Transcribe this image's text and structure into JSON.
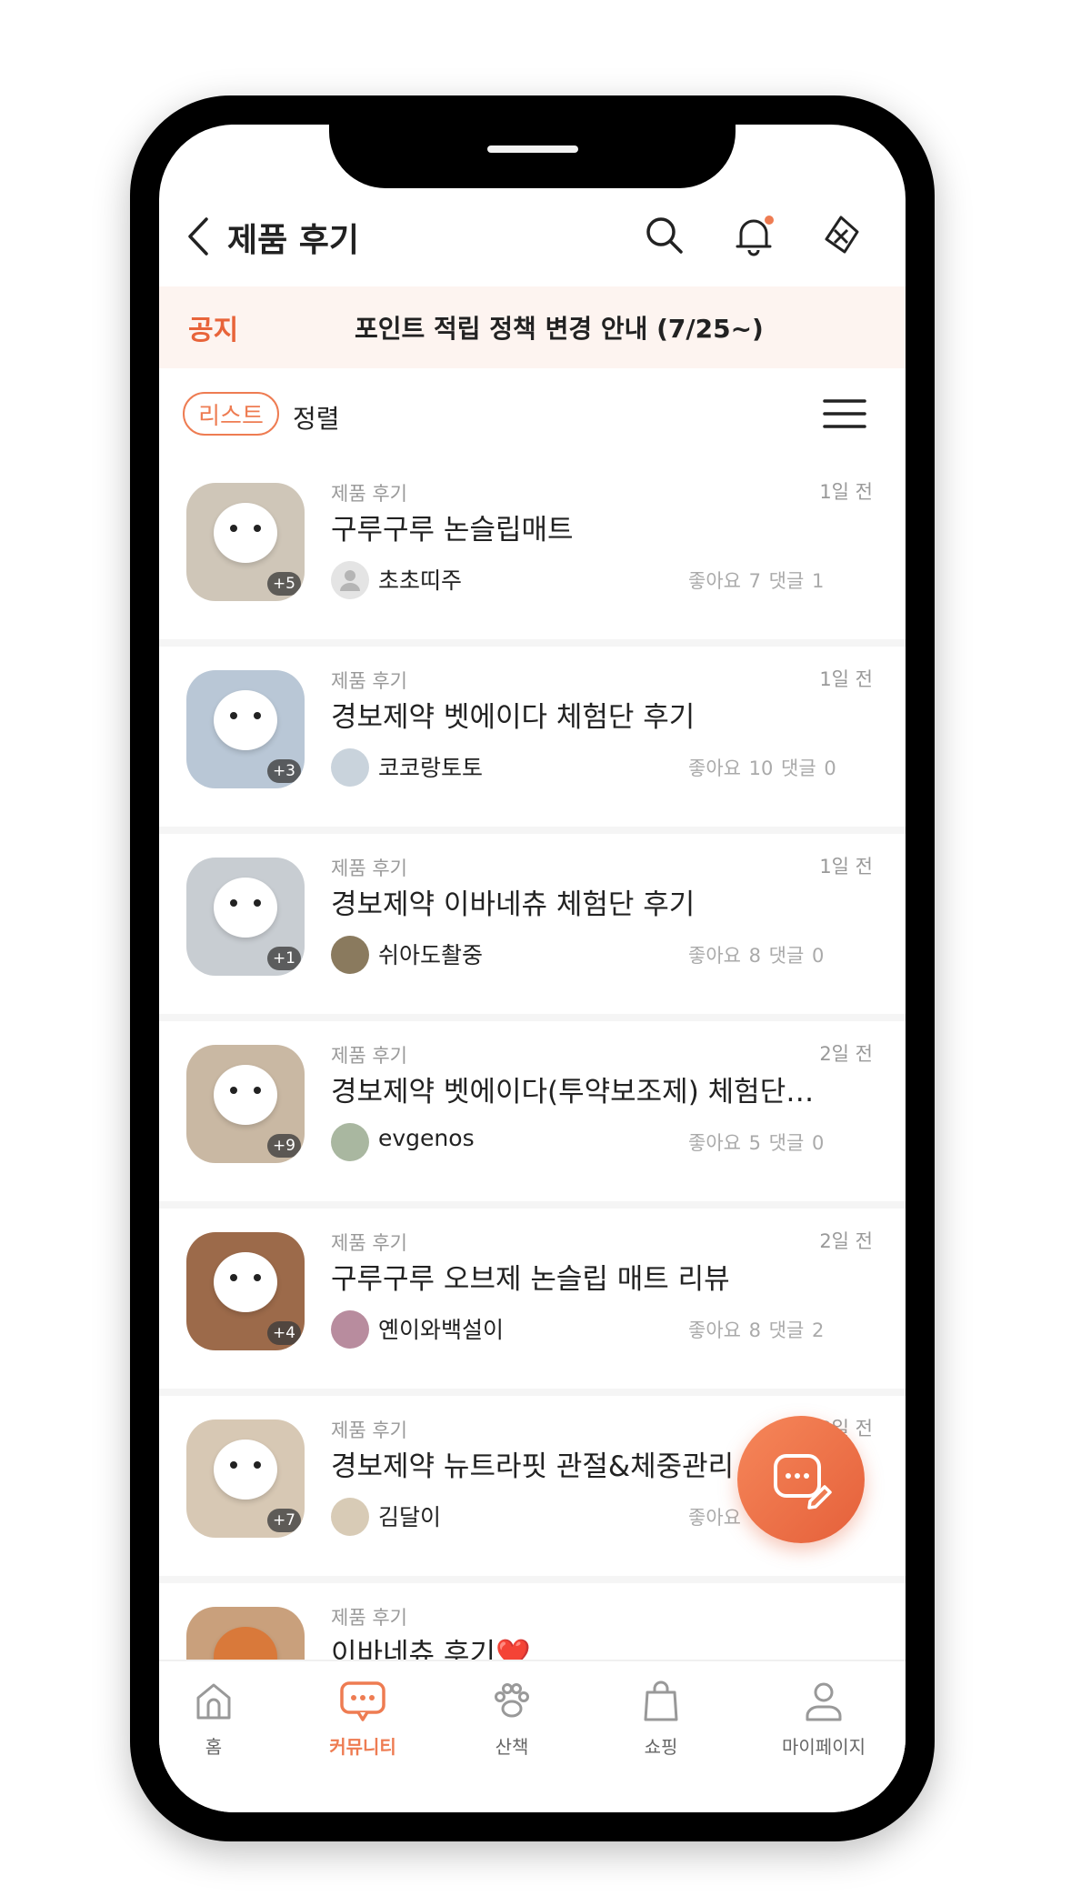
{
  "header": {
    "title": "제품 후기"
  },
  "notice": {
    "tag": "공지",
    "text": "포인트 적립 정책 변경 안내 (7/25~)"
  },
  "toolbar": {
    "list_label": "리스트",
    "sort_label": "정렬"
  },
  "posts": [
    {
      "category": "제품 후기",
      "time": "1일 전",
      "title": "구루구루 논슬립매트",
      "author": "초초띠주",
      "stats": "좋아요 7 댓글 1",
      "photo_count": "+5",
      "thumb_color": "#cfc6b8"
    },
    {
      "category": "제품 후기",
      "time": "1일 전",
      "title": "경보제약 벳에이다 체험단 후기",
      "author": "코코랑토토",
      "stats": "좋아요 10 댓글 0",
      "photo_count": "+3",
      "thumb_color": "#b9c7d6"
    },
    {
      "category": "제품 후기",
      "time": "1일 전",
      "title": "경보제약 이바네츄 체험단 후기",
      "author": "쉬아도촬중",
      "stats": "좋아요 8 댓글 0",
      "photo_count": "+1",
      "thumb_color": "#c8cdd2"
    },
    {
      "category": "제품 후기",
      "time": "2일 전",
      "title": "경보제약 벳에이다(투약보조제) 체험단…",
      "author": "evgenos",
      "stats": "좋아요 5 댓글 0",
      "photo_count": "+9",
      "thumb_color": "#c9b8a3"
    },
    {
      "category": "제품 후기",
      "time": "2일 전",
      "title": "구루구루 오브제 논슬립 매트 리뷰",
      "author": "옌이와백설이",
      "stats": "좋아요 8 댓글 2",
      "photo_count": "+4",
      "thumb_color": "#9c6a4a"
    },
    {
      "category": "제품 후기",
      "time": "3일 전",
      "title": "경보제약 뉴트라핏 관절&체중관리 사료…",
      "author": "김달이",
      "stats": "좋아요",
      "photo_count": "+7",
      "thumb_color": "#d7c8b4"
    },
    {
      "category": "제품 후기",
      "time": "",
      "title": "이바네츄 후기❤️",
      "author": "",
      "stats": "",
      "photo_count": "",
      "thumb_color": "#c9a07c"
    }
  ],
  "tabs": [
    {
      "label": "홈",
      "icon": "home-icon"
    },
    {
      "label": "커뮤니티",
      "icon": "chat-icon"
    },
    {
      "label": "산책",
      "icon": "paw-icon"
    },
    {
      "label": "쇼핑",
      "icon": "shopping-bag-icon"
    },
    {
      "label": "마이페이지",
      "icon": "profile-icon"
    }
  ],
  "colors": {
    "accent": "#ee7c52",
    "notice_bg": "#fdf4f0"
  }
}
